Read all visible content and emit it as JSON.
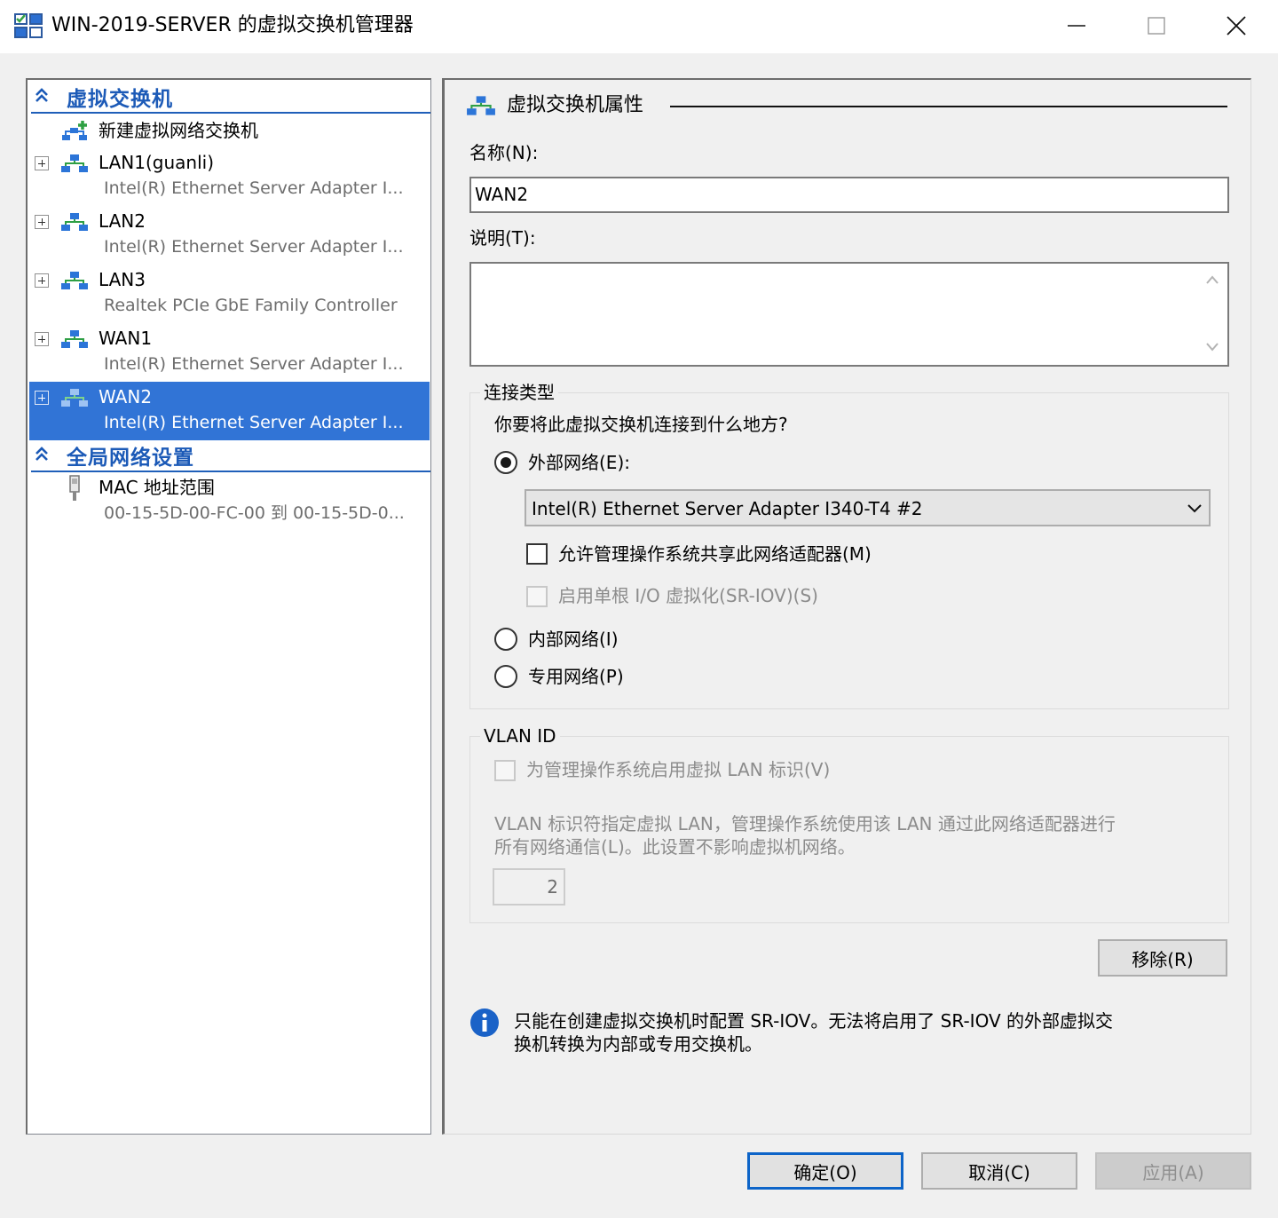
{
  "window": {
    "title": "WIN-2019-SERVER 的虚拟交换机管理器"
  },
  "sidebar": {
    "sections": [
      {
        "label": "虚拟交换机"
      },
      {
        "label": "全局网络设置"
      }
    ],
    "new_switch_label": "新建虚拟网络交换机",
    "switches": [
      {
        "name": "LAN1(guanli)",
        "adapter": "Intel(R) Ethernet Server Adapter I..."
      },
      {
        "name": "LAN2",
        "adapter": "Intel(R) Ethernet Server Adapter I..."
      },
      {
        "name": "LAN3",
        "adapter": "Realtek PCIe GbE Family Controller"
      },
      {
        "name": "WAN1",
        "adapter": "Intel(R) Ethernet Server Adapter I..."
      },
      {
        "name": "WAN2",
        "adapter": "Intel(R) Ethernet Server Adapter I..."
      }
    ],
    "selected_switch": "WAN2",
    "mac_range": {
      "name": "MAC 地址范围",
      "value": "00-15-5D-00-FC-00 到 00-15-5D-0..."
    }
  },
  "properties": {
    "header": "虚拟交换机属性",
    "name_label": "名称(N):",
    "name_value": "WAN2",
    "description_label": "说明(T):",
    "description_value": "",
    "connection_type": {
      "title": "连接类型",
      "question": "你要将此虚拟交换机连接到什么地方?",
      "external_label": "外部网络(E):",
      "external_selected": true,
      "adapter_selected": "Intel(R) Ethernet Server Adapter I340-T4 #2",
      "allow_management_os_label": "允许管理操作系统共享此网络适配器(M)",
      "sriov_label": "启用单根 I/O 虚拟化(SR-IOV)(S)",
      "internal_label": "内部网络(I)",
      "private_label": "专用网络(P)"
    },
    "vlan": {
      "title": "VLAN ID",
      "enable_label": "为管理操作系统启用虚拟 LAN 标识(V)",
      "description_line1": "VLAN 标识符指定虚拟 LAN，管理操作系统使用该 LAN 通过此网络适配器进行",
      "description_line2": "所有网络通信(L)。此设置不影响虚拟机网络。",
      "value": "2"
    },
    "remove_button": "移除(R)",
    "info_line1": "只能在创建虚拟交换机时配置 SR-IOV。无法将启用了 SR-IOV 的外部虚拟交",
    "info_line2": "换机转换为内部或专用交换机。"
  },
  "footer": {
    "ok": "确定(O)",
    "cancel": "取消(C)",
    "apply": "应用(A)"
  },
  "colors": {
    "accent": "#1c5ab7",
    "selection": "#3174d6",
    "info_icon": "#1a62c7"
  },
  "icons": [
    "app-icon",
    "minimize-icon",
    "maximize-icon",
    "close-icon",
    "collapse-chevron-icon",
    "add-switch-icon",
    "network-switch-icon",
    "mac-address-icon",
    "expand-icon",
    "dropdown-chevron-icon",
    "scroll-up-icon",
    "scroll-down-icon",
    "info-icon"
  ]
}
